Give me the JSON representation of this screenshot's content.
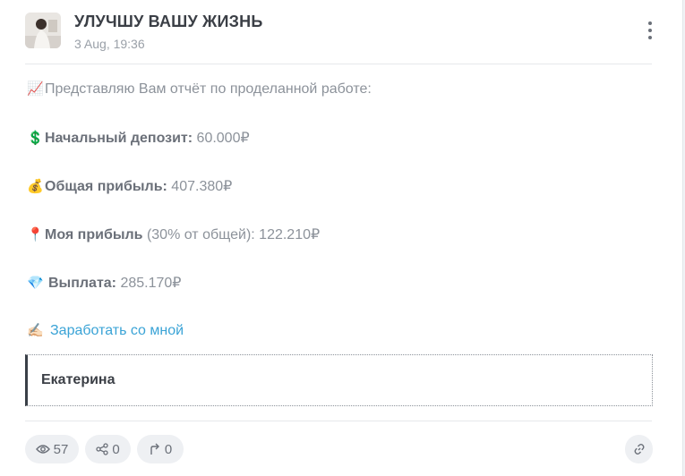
{
  "post": {
    "title": "УЛУЧШУ ВАШУ ЖИЗНЬ",
    "date": "3 Aug, 19:36"
  },
  "body": {
    "intro": {
      "emoji": "📈",
      "text": "Представляю Вам отчёт по проделанной работе:"
    },
    "deposit": {
      "emoji": "💲",
      "label": "Начальный депозит:",
      "value": " 60.000₽"
    },
    "profit": {
      "emoji": "💰",
      "label": "Общая прибыль:",
      "value": " 407.380₽"
    },
    "my_profit": {
      "emoji": "📍",
      "label": "Моя прибыль",
      "value": " (30% от общей): 122.210₽"
    },
    "payout": {
      "emoji": "💎",
      "label": "Выплата:",
      "value": " 285.170₽"
    },
    "cta": {
      "emoji": "✍🏻",
      "text": "Заработать со мной"
    }
  },
  "quote": {
    "text": "Екатерина"
  },
  "footer": {
    "views": "57",
    "shares": "0",
    "forwards": "0"
  },
  "colors": {
    "accent": "#3aa3d6",
    "text_dark": "#3b3f46",
    "text_muted": "#8c929a",
    "pill_bg": "#eef0f3"
  },
  "icons": [
    "more-vertical-icon",
    "eye-icon",
    "share-icon",
    "forward-icon",
    "link-icon"
  ]
}
